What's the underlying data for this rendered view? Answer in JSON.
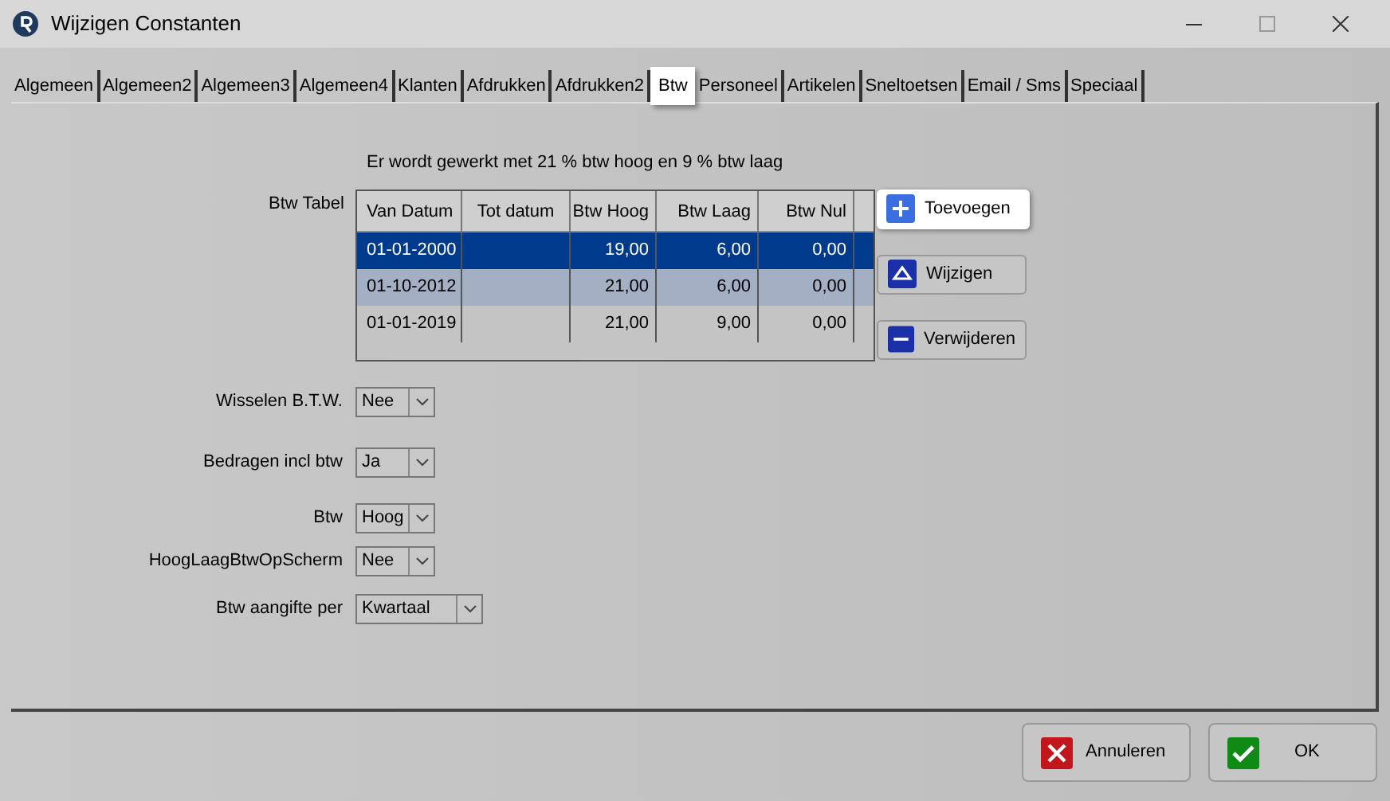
{
  "window": {
    "title": "Wijzigen Constanten"
  },
  "tabs": [
    {
      "label": "Algemeen",
      "selected": false
    },
    {
      "label": "Algemeen2",
      "selected": false
    },
    {
      "label": "Algemeen3",
      "selected": false
    },
    {
      "label": "Algemeen4",
      "selected": false
    },
    {
      "label": "Klanten",
      "selected": false
    },
    {
      "label": "Afdrukken",
      "selected": false
    },
    {
      "label": "Afdrukken2",
      "selected": false
    },
    {
      "label": "Btw",
      "selected": true
    },
    {
      "label": "Personeel",
      "selected": false
    },
    {
      "label": "Artikelen",
      "selected": false
    },
    {
      "label": "Sneltoetsen",
      "selected": false
    },
    {
      "label": "Email / Sms",
      "selected": false
    },
    {
      "label": "Speciaal",
      "selected": false
    }
  ],
  "info_text": "Er wordt gewerkt met 21 % btw hoog en 9 % btw laag",
  "btw_table": {
    "label": "Btw Tabel",
    "columns": [
      "Van Datum",
      "Tot datum",
      "Btw Hoog",
      "Btw Laag",
      "Btw Nul"
    ],
    "rows": [
      {
        "cells": [
          "01-01-2000",
          "",
          "19,00",
          "6,00",
          "0,00"
        ],
        "selected": true,
        "highlighted": false
      },
      {
        "cells": [
          "01-10-2012",
          "",
          "21,00",
          "6,00",
          "0,00"
        ],
        "selected": false,
        "highlighted": true
      },
      {
        "cells": [
          "01-01-2019",
          "",
          "21,00",
          "9,00",
          "0,00"
        ],
        "selected": false,
        "highlighted": false
      }
    ]
  },
  "table_buttons": [
    {
      "label": "Toevoegen",
      "kind": "add",
      "focused": true
    },
    {
      "label": "Wijzigen",
      "kind": "edit",
      "focused": false
    },
    {
      "label": "Verwijderen",
      "kind": "delete",
      "focused": false
    }
  ],
  "fields": [
    {
      "label": "Wisselen B.T.W.",
      "value": "Nee",
      "wide": false
    },
    {
      "label": "Bedragen incl btw",
      "value": "Ja",
      "wide": false
    },
    {
      "label": "Btw",
      "value": "Hoog",
      "wide": false
    },
    {
      "label": "HoogLaagBtwOpScherm",
      "value": "Nee",
      "wide": false
    },
    {
      "label": "Btw aangifte per",
      "value": "Kwartaal",
      "wide": true
    }
  ],
  "footer_buttons": [
    {
      "label": "Annuleren",
      "kind": "cancel"
    },
    {
      "label": "OK",
      "kind": "ok"
    }
  ]
}
